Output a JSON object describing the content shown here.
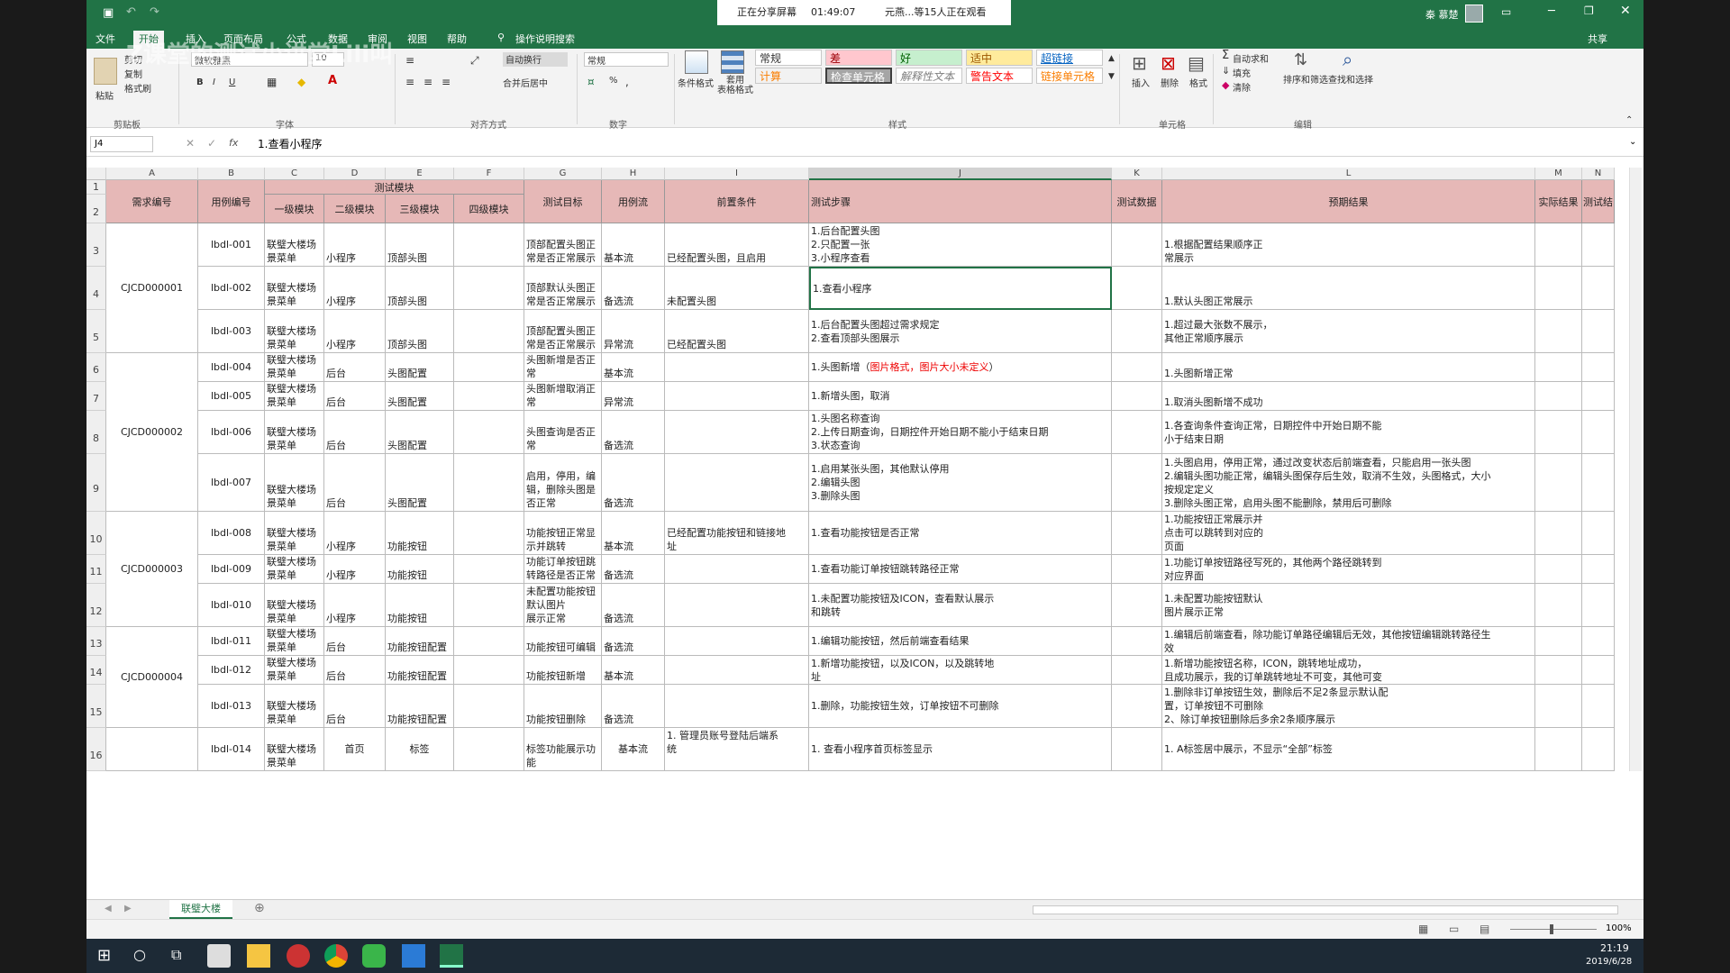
{
  "share_banner": {
    "sharing": "正在分享屏幕",
    "time": "01:49:07",
    "viewers": "元燕...等15人正在观看"
  },
  "watermark": "Z课堂的测试小讲堂Lili叫",
  "title_user": "秦 慕楚",
  "menu_tabs": [
    "文件",
    "开始",
    "插入",
    "页面布局",
    "公式",
    "数据",
    "审阅",
    "视图",
    "帮助",
    "操作说明搜索"
  ],
  "share_label": "共享",
  "ribbon": {
    "clipboard": {
      "paste": "粘贴",
      "cut": "剪切",
      "copy": "复制",
      "format_painter": "格式刷",
      "label": "剪贴板"
    },
    "font": {
      "name": "微软雅黑",
      "size": "10",
      "label": "字体",
      "bold": "B",
      "italic": "I",
      "underline": "U"
    },
    "align": {
      "wrap": "自动换行",
      "merge": "合并后居中",
      "label": "对齐方式"
    },
    "number": {
      "format": "常规",
      "label": "数字",
      "percent": "%"
    },
    "styles": {
      "cond": "条件格式",
      "table": "套用\n表格格式",
      "label": "样式",
      "normal": "常规",
      "bad": "差",
      "good": "好",
      "neutral": "适中",
      "hyperlink": "超链接",
      "calc": "计算",
      "check": "检查单元格",
      "explain": "解释性文本",
      "warn": "警告文本",
      "linked": "链接单元格"
    },
    "cells": {
      "insert": "插入",
      "delete": "删除",
      "format": "格式",
      "label": "单元格"
    },
    "edit": {
      "autosum": "自动求和",
      "fill": "填充",
      "clear": "清除",
      "sort": "排序和筛选",
      "find": "查找和选择",
      "label": "编辑"
    }
  },
  "formula_bar": {
    "name_box": "J4",
    "fx": "fx",
    "content": "1.查看小程序"
  },
  "columns": [
    "A",
    "B",
    "C",
    "D",
    "E",
    "F",
    "G",
    "H",
    "I",
    "J",
    "K",
    "L",
    "M",
    "N"
  ],
  "headers": {
    "req": "需求编号",
    "case": "用例编号",
    "module": "测试模块",
    "m1": "一级模块",
    "m2": "二级模块",
    "m3": "三级模块",
    "m4": "四级模块",
    "goal": "测试目标",
    "flow": "用例流",
    "pre": "前置条件",
    "steps": "测试步骤",
    "data": "测试数据",
    "expect": "预期结果",
    "actual": "实际结果",
    "result": "测试结"
  },
  "row_numbers": [
    "1",
    "2",
    "3",
    "4",
    "5",
    "6",
    "7",
    "8",
    "9",
    "10",
    "11",
    "12",
    "13",
    "14",
    "15",
    "16"
  ],
  "req_ids": [
    "CJCD000001",
    "CJCD000002",
    "CJCD000003",
    "CJCD000004"
  ],
  "rows": [
    {
      "n": "3",
      "id": "lbdl-001",
      "m1": "联璧大楼场\n景菜单",
      "m2": "小程序",
      "m3": "顶部头图",
      "goal": "顶部配置头图正\n常是否正常展示",
      "flow": "基本流",
      "pre": "已经配置头图，且启用",
      "steps": "1.后台配置头图\n2.只配置一张\n3.小程序查看",
      "expect": "1.根据配置结果顺序正\n常展示"
    },
    {
      "n": "4",
      "id": "lbdl-002",
      "m1": "联璧大楼场\n景菜单",
      "m2": "小程序",
      "m3": "顶部头图",
      "goal": "顶部默认头图正\n常是否正常展示",
      "flow": "备选流",
      "pre": "未配置头图",
      "steps": "1.查看小程序",
      "expect": "1.默认头图正常展示"
    },
    {
      "n": "5",
      "id": "lbdl-003",
      "m1": "联璧大楼场\n景菜单",
      "m2": "小程序",
      "m3": "顶部头图",
      "goal": "顶部配置头图正\n常是否正常展示",
      "flow": "异常流",
      "pre": "已经配置头图",
      "steps": "1.后台配置头图超过需求规定\n2.查看顶部头图展示",
      "expect": "1.超过最大张数不展示，\n其他正常顺序展示"
    },
    {
      "n": "6",
      "id": "lbdl-004",
      "m1": "联璧大楼场\n景菜单",
      "m2": "后台",
      "m3": "头图配置",
      "goal": "头图新增是否正\n常",
      "flow": "基本流",
      "pre": "",
      "steps": "1.头图新增（",
      "steps_red": "图片格式，图片大小未定义",
      "steps_end": "）",
      "expect": "1.头图新增正常"
    },
    {
      "n": "7",
      "id": "lbdl-005",
      "m1": "联璧大楼场\n景菜单",
      "m2": "后台",
      "m3": "头图配置",
      "goal": "头图新增取消正\n常",
      "flow": "异常流",
      "pre": "",
      "steps": "1.新增头图，取消",
      "expect": "1.取消头图新增不成功"
    },
    {
      "n": "8",
      "id": "lbdl-006",
      "m1": "联璧大楼场\n景菜单",
      "m2": "后台",
      "m3": "头图配置",
      "goal": "头图查询是否正\n常",
      "flow": "备选流",
      "pre": "",
      "steps": "1.头图名称查询\n2.上传日期查询，日期控件开始日期不能小于结束日期\n3.状态查询",
      "expect": "1.各查询条件查询正常，日期控件中开始日期不能\n小于结束日期"
    },
    {
      "n": "9",
      "id": "lbdl-007",
      "m1": "联璧大楼场\n景菜单",
      "m2": "后台",
      "m3": "头图配置",
      "goal": "启用，停用，编\n辑，删除头图是\n否正常",
      "flow": "备选流",
      "pre": "",
      "steps": "1.启用某张头图，其他默认停用\n2.编辑头图\n3.删除头图",
      "expect": "1.头图启用，停用正常，通过改变状态后前端查看，只能启用一张头图\n2.编辑头图功能正常，编辑头图保存后生效，取消不生效，头图格式，大小\n按规定定义\n3.删除头图正常，启用头图不能删除，禁用后可删除"
    },
    {
      "n": "10",
      "id": "lbdl-008",
      "m1": "联璧大楼场\n景菜单",
      "m2": "小程序",
      "m3": "功能按钮",
      "goal": "功能按钮正常显\n示并跳转",
      "flow": "基本流",
      "pre": "已经配置功能按钮和链接地\n址",
      "steps": "1.查看功能按钮是否正常",
      "expect": "1.功能按钮正常展示并\n点击可以跳转到对应的\n页面"
    },
    {
      "n": "11",
      "id": "lbdl-009",
      "m1": "联璧大楼场\n景菜单",
      "m2": "小程序",
      "m3": "功能按钮",
      "goal": "功能订单按钮跳\n转路径是否正常",
      "flow": "备选流",
      "pre": "",
      "steps": "1.查看功能订单按钮跳转路径正常",
      "expect": "1.功能订单按钮路径写死的，其他两个路径跳转到\n对应界面"
    },
    {
      "n": "12",
      "id": "lbdl-010",
      "m1": "联璧大楼场\n景菜单",
      "m2": "小程序",
      "m3": "功能按钮",
      "goal": "未配置功能按钮\n默认图片\n展示正常",
      "flow": "备选流",
      "pre": "",
      "steps": "1.未配置功能按钮及ICON，查看默认展示\n和跳转",
      "expect": "1.未配置功能按钮默认\n图片展示正常"
    },
    {
      "n": "13",
      "id": "lbdl-011",
      "m1": "联璧大楼场\n景菜单",
      "m2": "后台",
      "m3": "功能按钮配置",
      "goal": "功能按钮可编辑",
      "flow": "备选流",
      "pre": "",
      "steps": "1.编辑功能按钮，然后前端查看结果",
      "expect": "1.编辑后前端查看，除功能订单路径编辑后无效，其他按钮编辑跳转路径生\n效"
    },
    {
      "n": "14",
      "id": "lbdl-012",
      "m1": "联璧大楼场\n景菜单",
      "m2": "后台",
      "m3": "功能按钮配置",
      "goal": "功能按钮新增",
      "flow": "基本流",
      "pre": "",
      "steps": "1.新增功能按钮，以及ICON，以及跳转地\n址",
      "expect": "1.新增功能按钮名称，ICON，跳转地址成功，\n且成功展示，我的订单跳转地址不可变，其他可变"
    },
    {
      "n": "15",
      "id": "lbdl-013",
      "m1": "联璧大楼场\n景菜单",
      "m2": "后台",
      "m3": "功能按钮配置",
      "goal": "功能按钮删除",
      "flow": "备选流",
      "pre": "",
      "steps": "1.删除，功能按钮生效，订单按钮不可删除",
      "expect": "1.删除非订单按钮生效，删除后不足2条显示默认配\n置，订单按钮不可删除\n2、除订单按钮删除后多余2条顺序展示"
    },
    {
      "n": "16",
      "id": "lbdl-014",
      "m1": "联璧大楼场\n景菜单",
      "m2": "首页",
      "m3": "标签",
      "goal": "标签功能展示功\n能",
      "flow": "基本流",
      "pre": "1. 管理员账号登陆后端系\n统",
      "steps": "1. 查看小程序首页标签显示",
      "expect": "1. A标签居中展示，不显示“全部”标签"
    }
  ],
  "sheet_tab": "联璧大楼",
  "zoom": "100%",
  "clock": {
    "time": "21:19",
    "date": "2019/6/28"
  }
}
